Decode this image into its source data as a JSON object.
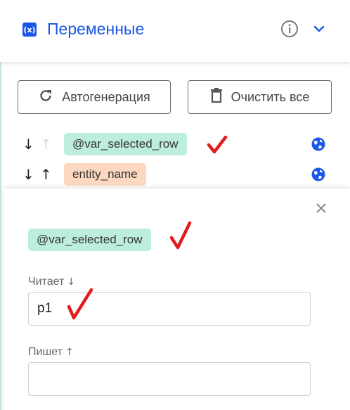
{
  "header": {
    "icon_text": "(x)",
    "title": "Переменные"
  },
  "toolbar": {
    "autogen_label": "Автогенерация",
    "clear_all_label": "Очистить все"
  },
  "variables": [
    {
      "name": "@var_selected_row",
      "reads_active": true,
      "writes_active": false,
      "chip_color": "#bdeedd"
    },
    {
      "name": "entity_name",
      "reads_active": true,
      "writes_active": true,
      "chip_color": "#fcd8c0"
    }
  ],
  "arrows": {
    "down": "↓",
    "up": "↑"
  },
  "detail": {
    "variable_name": "@var_selected_row",
    "reads_label": "Читает",
    "reads_value": "p1",
    "writes_label": "Пишет",
    "writes_value": ""
  },
  "colors": {
    "accent": "#1a56e8",
    "chip_green": "#bdeedd",
    "chip_peach": "#fcd8c0",
    "annotation_check": "#e21b1b"
  }
}
